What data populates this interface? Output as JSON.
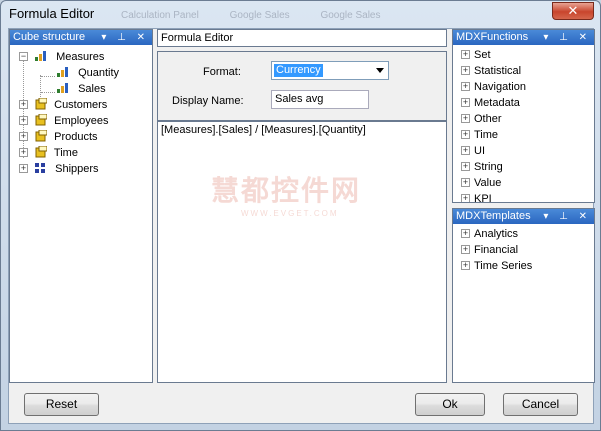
{
  "window": {
    "title": "Formula Editor",
    "ghost_tabs": [
      "Calculation Panel",
      "Google Sales",
      "Google Sales"
    ],
    "close_glyph": "✕"
  },
  "cube_panel": {
    "title": "Cube structure",
    "controls": "▾ ⊥ ✕",
    "items": [
      {
        "label": "Measures",
        "icon": "measure-icon",
        "expander": "−"
      },
      {
        "label": "Quantity",
        "icon": "measure-icon"
      },
      {
        "label": "Sales",
        "icon": "measure-icon"
      },
      {
        "label": "Customers",
        "icon": "dimension-icon",
        "expander": "+"
      },
      {
        "label": "Employees",
        "icon": "dimension-icon",
        "expander": "+"
      },
      {
        "label": "Products",
        "icon": "dimension-icon",
        "expander": "+"
      },
      {
        "label": "Time",
        "icon": "dimension-icon",
        "expander": "+"
      },
      {
        "label": "Shippers",
        "icon": "grid-icon",
        "expander": "+"
      }
    ]
  },
  "editor": {
    "title": "Formula Editor",
    "format_label": "Format:",
    "format_value": "Currency",
    "display_name_label": "Display Name:",
    "display_name_value": "Sales avg",
    "formula": "[Measures].[Sales] / [Measures].[Quantity]"
  },
  "watermark": {
    "big": "慧都控件网",
    "small": "WWW.EVGET.COM"
  },
  "functions_panel": {
    "title": "MDXFunctions",
    "controls": "▾ ⊥ ✕",
    "items": [
      "Set",
      "Statistical",
      "Navigation",
      "Metadata",
      "Other",
      "Time",
      "UI",
      "String",
      "Value",
      "KPI"
    ]
  },
  "templates_panel": {
    "title": "MDXTemplates",
    "controls": "▾ ⊥ ✕",
    "items": [
      "Analytics",
      "Financial",
      "Time Series"
    ]
  },
  "buttons": {
    "reset": "Reset",
    "ok": "Ok",
    "cancel": "Cancel"
  },
  "colors": {
    "panel_header": "#2a66c0",
    "selection": "#3399ff"
  }
}
